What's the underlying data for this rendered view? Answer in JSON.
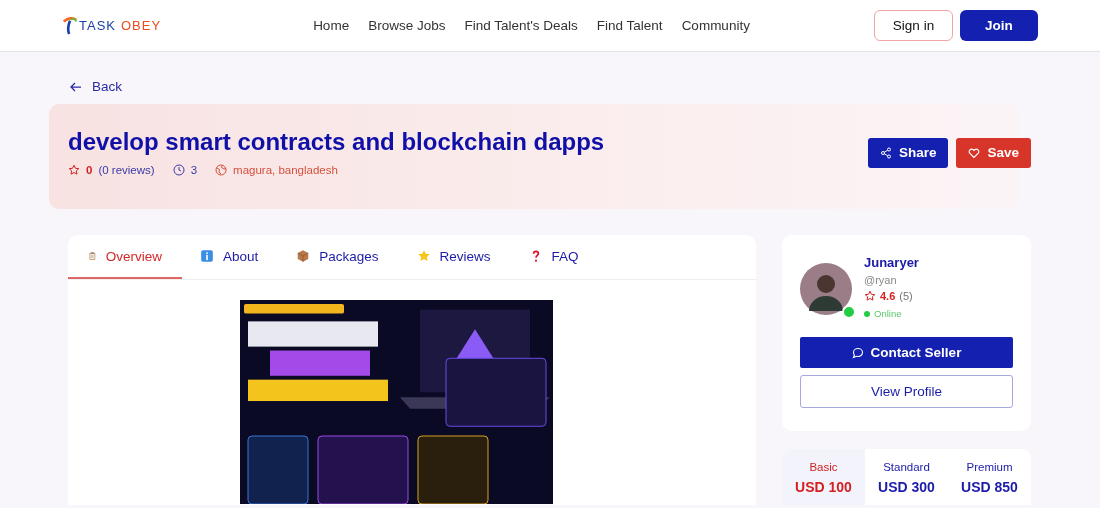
{
  "header": {
    "logo": {
      "part_1": "TASK",
      "part_2": "OBEY"
    },
    "nav": [
      "Home",
      "Browse Jobs",
      "Find Talent's Deals",
      "Find Talent",
      "Community"
    ],
    "sign_in": "Sign in",
    "join": "Join"
  },
  "back": "Back",
  "gig": {
    "title": "develop smart contracts and blockchain dapps",
    "rating": "0",
    "reviews": "(0 reviews)",
    "orders": "3",
    "location": "magura, bangladesh",
    "share": "Share",
    "save": "Save"
  },
  "tabs": [
    {
      "label": "Overview",
      "selected": true
    },
    {
      "label": "About",
      "selected": false
    },
    {
      "label": "Packages",
      "selected": false
    },
    {
      "label": "Reviews",
      "selected": false
    },
    {
      "label": "FAQ",
      "selected": false
    }
  ],
  "seller": {
    "name": "Junaryer",
    "handle": "@ryan",
    "rating": "4.6",
    "rating_count": "(5)",
    "online": true,
    "status": "Online",
    "contact": "Contact Seller",
    "view_profile": "View Profile"
  },
  "packages": [
    {
      "name": "Basic",
      "price": "USD 100",
      "selected": true
    },
    {
      "name": "Standard",
      "price": "USD 300",
      "selected": false
    },
    {
      "name": "Premium",
      "price": "USD 850",
      "selected": false
    }
  ]
}
